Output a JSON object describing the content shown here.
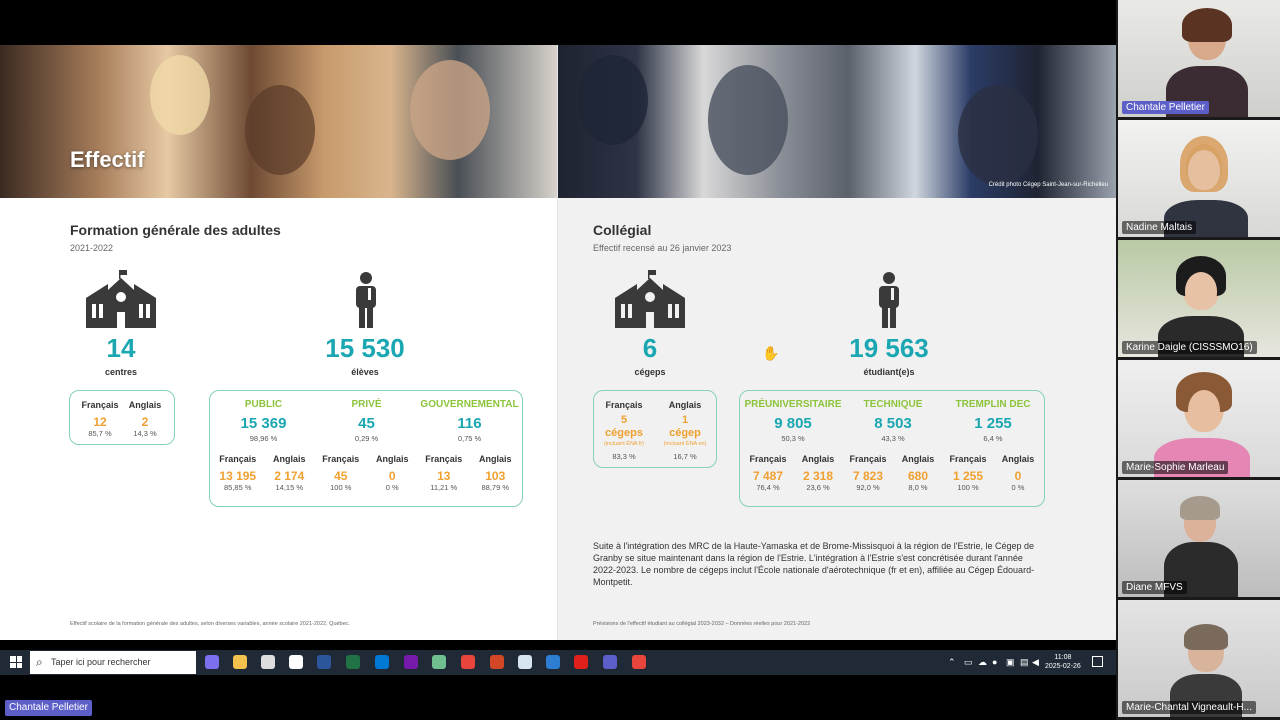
{
  "left_slide": {
    "banner_title": "Effectif",
    "section_title": "Formation générale des adultes",
    "section_sub": "2021-2022",
    "centres_value": "14",
    "centres_label": "centres",
    "eleves_value": "15 530",
    "eleves_label": "élèves",
    "lang_box": {
      "fr_label": "Français",
      "en_label": "Anglais",
      "fr_value": "12",
      "en_value": "2",
      "fr_pct": "85,7 %",
      "en_pct": "14,3 %"
    },
    "groups": [
      {
        "label": "PUBLIC",
        "value": "15 369",
        "pct": "98,96 %",
        "fr_label": "Français",
        "en_label": "Anglais",
        "fr_value": "13 195",
        "en_value": "2 174",
        "fr_pct": "85,85 %",
        "en_pct": "14,15 %"
      },
      {
        "label": "PRIVÉ",
        "value": "45",
        "pct": "0,29 %",
        "fr_label": "Français",
        "en_label": "Anglais",
        "fr_value": "45",
        "en_value": "0",
        "fr_pct": "100 %",
        "en_pct": "0 %"
      },
      {
        "label": "GOUVERNEMENTAL",
        "value": "116",
        "pct": "0,75 %",
        "fr_label": "Français",
        "en_label": "Anglais",
        "fr_value": "13",
        "en_value": "103",
        "fr_pct": "11,21 %",
        "en_pct": "88,79 %"
      }
    ],
    "footnote": "Effectif scolaire de la formation générale des adultes, selon diverses variables, année scolaire 2021-2022, Québec."
  },
  "right_slide": {
    "credit": "Crédit photo Cégep Saint-Jean-sur-Richelieu",
    "section_title": "Collégial",
    "section_sub": "Effectif recensé au 26 janvier 2023",
    "cegeps_value": "6",
    "cegeps_label": "cégeps",
    "etudiants_value": "19 563",
    "etudiants_label": "étudiant(e)s",
    "lang_box": {
      "fr_label": "Français",
      "en_label": "Anglais",
      "fr_value_1": "5",
      "fr_value_2": "cégeps",
      "en_value_1": "1",
      "en_value_2": "cégep",
      "fr_note": "(incluant ÉNA fr)",
      "en_note": "(incluant ÉNA en)",
      "fr_pct": "83,3 %",
      "en_pct": "16,7 %"
    },
    "groups": [
      {
        "label": "PRÉUNIVERSITAIRE",
        "value": "9 805",
        "pct": "50,3 %",
        "fr_label": "Français",
        "en_label": "Anglais",
        "fr_value": "7 487",
        "en_value": "2 318",
        "fr_pct": "76,4 %",
        "en_pct": "23,6 %"
      },
      {
        "label": "TECHNIQUE",
        "value": "8 503",
        "pct": "43,3 %",
        "fr_label": "Français",
        "en_label": "Anglais",
        "fr_value": "7 823",
        "en_value": "680",
        "fr_pct": "92,0 %",
        "en_pct": "8,0 %"
      },
      {
        "label": "TREMPLIN DEC",
        "value": "1 255",
        "pct": "6,4 %",
        "fr_label": "Français",
        "en_label": "Anglais",
        "fr_value": "1 255",
        "en_value": "0",
        "fr_pct": "100 %",
        "en_pct": "0 %"
      }
    ],
    "paragraph": "Suite à l'intégration des MRC de la Haute-Yamaska et de Brome-Missisquoi à la région de l'Estrie, le Cégep de Granby se situe maintenant dans la région de l'Estrie. L'intégration à l'Estrie s'est concrétisée durant l'année 2022-2023. Le nombre de cégeps inclut l'École nationale d'aérotechnique (fr et en), affiliée au Cégep Édouard-Montpetit.",
    "footnote": "Prévisions de l'effectif étudiant au collégial 2023-2032 – Données réelles pour 2021-2022"
  },
  "participants": [
    {
      "name": "Chantale Pelletier",
      "active": true
    },
    {
      "name": "Nadine Maltais"
    },
    {
      "name": "Karine Daigle (CISSSMO16)"
    },
    {
      "name": "Marie-Sophie Marleau"
    },
    {
      "name": "Diane MFVS"
    },
    {
      "name": "Marie-Chantal Vigneault-H..."
    }
  ],
  "taskbar": {
    "search_placeholder": "Taper ici pour rechercher",
    "time": "11:08",
    "date": "2025-02-26",
    "app_icons": [
      {
        "name": "copilot-icon",
        "color": "#7b6ff0"
      },
      {
        "name": "file-explorer-icon",
        "color": "#f2c14e"
      },
      {
        "name": "task-view-icon",
        "color": "#dddddd"
      },
      {
        "name": "teams-meeting-icon",
        "color": "#ffffff"
      },
      {
        "name": "word-icon",
        "color": "#2b579a"
      },
      {
        "name": "excel-icon",
        "color": "#217346"
      },
      {
        "name": "outlook-icon",
        "color": "#0078d4"
      },
      {
        "name": "onenote-icon",
        "color": "#7719aa"
      },
      {
        "name": "notes-icon",
        "color": "#6fbf8f"
      },
      {
        "name": "chrome-icon",
        "color": "#e8453c"
      },
      {
        "name": "powerpoint-icon",
        "color": "#d24726"
      },
      {
        "name": "snipping-icon",
        "color": "#d6e4f0"
      },
      {
        "name": "calendar-icon",
        "color": "#2d7dd2"
      },
      {
        "name": "acrobat-icon",
        "color": "#e0201b"
      },
      {
        "name": "teams-icon",
        "color": "#5b5fc7"
      },
      {
        "name": "chrome-profile-icon",
        "color": "#e8453c"
      }
    ]
  },
  "presenter_label": "Chantale Pelletier"
}
